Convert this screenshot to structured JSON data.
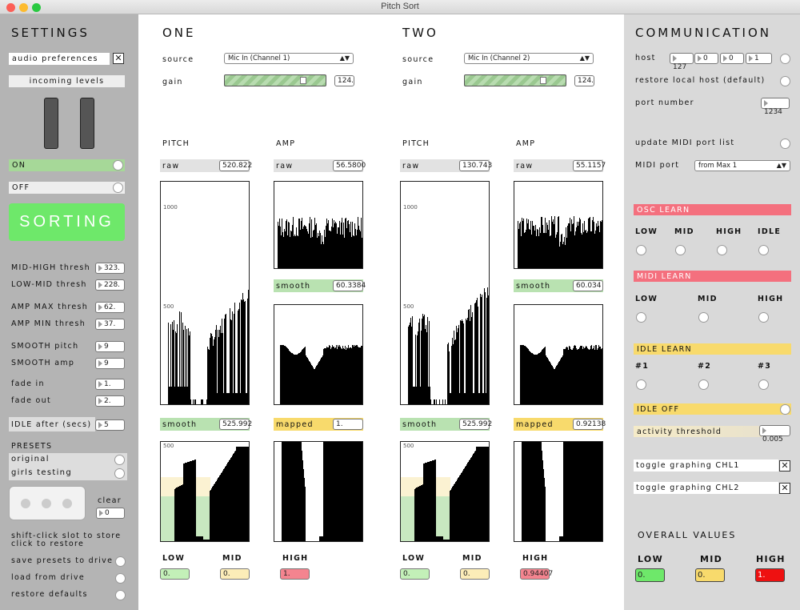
{
  "window": {
    "title": "Pitch Sort"
  },
  "settings": {
    "header": "SETTINGS",
    "audio_prefs": "audio preferences",
    "incoming_levels": "incoming levels",
    "on": "ON",
    "off": "OFF",
    "sorting": "SORTING",
    "params": [
      {
        "label": "MID-HIGH thresh",
        "value": "323."
      },
      {
        "label": "LOW-MID thresh",
        "value": "228."
      },
      {
        "label": "AMP MAX thresh",
        "value": "62."
      },
      {
        "label": "AMP MIN thresh",
        "value": "37."
      },
      {
        "label": "SMOOTH pitch",
        "value": "9"
      },
      {
        "label": "SMOOTH amp",
        "value": "9"
      },
      {
        "label": "fade in",
        "value": "1."
      },
      {
        "label": "fade out",
        "value": "2."
      },
      {
        "label": "IDLE after (secs)",
        "value": "5"
      }
    ],
    "presets_header": "PRESETS",
    "presets": [
      "original",
      "girls testing"
    ],
    "clear": "clear",
    "clear_value": "0",
    "hint1": "shift-click slot to store",
    "hint2": "click to restore",
    "actions": [
      "save presets to drive",
      "load from drive",
      "restore defaults"
    ]
  },
  "channels": [
    {
      "title": "ONE",
      "source_label": "source",
      "source": "Mic In (Channel 1)",
      "gain_label": "gain",
      "gain": "124.",
      "pitch_label": "PITCH",
      "amp_label": "AMP",
      "raw_label": "raw",
      "pitch_raw": "520.822",
      "amp_raw": "56.5800",
      "smooth_label": "smooth",
      "amp_smooth": "60.3384",
      "pitch_smooth": "525.992",
      "mapped_label": "mapped",
      "mapped": "1.",
      "tick_1000": "1000",
      "tick_500": "500",
      "tick_500b": "500",
      "low_label": "LOW",
      "mid_label": "MID",
      "high_label": "HIGH",
      "low": "0.",
      "mid": "0.",
      "high": "1."
    },
    {
      "title": "TWO",
      "source_label": "source",
      "source": "Mic In (Channel 2)",
      "gain_label": "gain",
      "gain": "124.",
      "pitch_label": "PITCH",
      "amp_label": "AMP",
      "raw_label": "raw",
      "pitch_raw": "130.743",
      "amp_raw": "55.1157",
      "smooth_label": "smooth",
      "amp_smooth": "60.034",
      "pitch_smooth": "525.992",
      "mapped_label": "mapped",
      "mapped": "0.92138",
      "tick_1000": "1000",
      "tick_500": "500",
      "tick_500b": "500",
      "low_label": "LOW",
      "mid_label": "MID",
      "high_label": "HIGH",
      "low": "0.",
      "mid": "0.",
      "high": "0.94407"
    }
  ],
  "comm": {
    "header": "COMMUNICATION",
    "host_label": "host",
    "host": [
      "127",
      "0",
      "0",
      "1"
    ],
    "restore_host": "restore local host (default)",
    "port_label": "port number",
    "port": "1234",
    "update_midi": "update MIDI port list",
    "midi_port_label": "MIDI port",
    "midi_port": "from Max 1",
    "osc_learn": "OSC LEARN",
    "osc_items": [
      "LOW",
      "MID",
      "HIGH",
      "IDLE"
    ],
    "midi_learn": "MIDI LEARN",
    "midi_items": [
      "LOW",
      "MID",
      "HIGH"
    ],
    "idle_learn": "IDLE LEARN",
    "idle_items": [
      "#1",
      "#2",
      "#3"
    ],
    "idle_off": "IDLE OFF",
    "activity_label": "activity threshold",
    "activity": "0.005",
    "toggle1": "toggle graphing CHL1",
    "toggle2": "toggle graphing CHL2",
    "overall_header": "OVERALL VALUES",
    "overall_labels": [
      "LOW",
      "MID",
      "HIGH"
    ],
    "overall_values": [
      "0.",
      "0.",
      "1."
    ]
  },
  "colors": {
    "green": "#b9e2b1",
    "yellow": "#f8da6c",
    "red": "#f4707e",
    "sorting": "#6ee86a"
  }
}
